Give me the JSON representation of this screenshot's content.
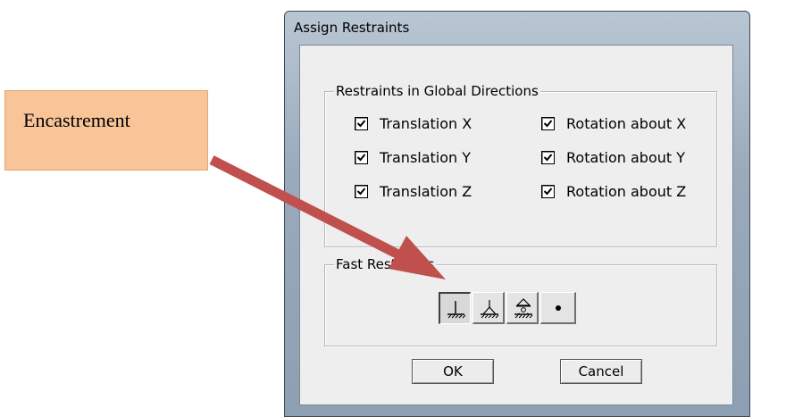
{
  "annotation": {
    "label": "Encastrement"
  },
  "dialog": {
    "title": "Assign Restraints",
    "global_group": {
      "legend": "Restraints in Global Directions",
      "checkboxes": [
        {
          "label": "Translation X",
          "checked": true
        },
        {
          "label": "Rotation about X",
          "checked": true
        },
        {
          "label": "Translation Y",
          "checked": true
        },
        {
          "label": "Rotation about Y",
          "checked": true
        },
        {
          "label": "Translation Z",
          "checked": true
        },
        {
          "label": "Rotation about Z",
          "checked": true
        }
      ]
    },
    "fast_group": {
      "legend": "Fast Restraints",
      "buttons": [
        {
          "icon": "fixed-support-icon",
          "pressed": true
        },
        {
          "icon": "pinned-support-icon",
          "pressed": false
        },
        {
          "icon": "roller-support-icon",
          "pressed": false
        },
        {
          "icon": "free-node-icon",
          "pressed": false
        }
      ]
    },
    "ok_label": "OK",
    "cancel_label": "Cancel"
  }
}
